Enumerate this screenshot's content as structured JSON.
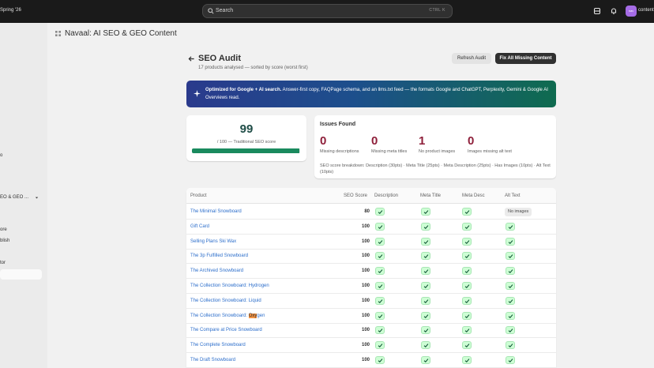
{
  "topbar": {
    "left_text": "Spring '26",
    "search_placeholder": "Search",
    "search_shortcut": "CTRL  K",
    "avatar_initials": "nav",
    "store_name": "content"
  },
  "sidebar": {
    "items": [
      {
        "label": "o"
      },
      {
        "label": "EO & GEO ..."
      },
      {
        "label": "ore"
      },
      {
        "label": "blish"
      },
      {
        "label": "tor"
      }
    ]
  },
  "app": {
    "title": "Navaal: AI SEO & GEO Content"
  },
  "page": {
    "title": "SEO Audit",
    "subtitle": "17 products analysed — sorted by score (worst first)",
    "refresh_label": "Refresh Audit",
    "fix_label": "Fix All Missing Content"
  },
  "banner": {
    "bold": "Optimized for Google + AI search.",
    "text": " Answer-first copy, FAQPage schema, and an llms.txt feed — the formats Google and ChatGPT, Perplexity, Gemini & Google AI Overviews read."
  },
  "score": {
    "value": "99",
    "label": "/ 100 — Traditional SEO score",
    "fill_fraction": 0.99
  },
  "issues": {
    "title": "Issues Found",
    "items": [
      {
        "count": "0",
        "label": "Missing descriptions"
      },
      {
        "count": "0",
        "label": "Missing meta titles"
      },
      {
        "count": "1",
        "label": "No product images"
      },
      {
        "count": "0",
        "label": "Images missing alt text"
      }
    ],
    "note": "SEO score breakdown: Description (30pts) · Meta Title (25pts) · Meta Description (25pts) · Has Images (10pts) · Alt Text (10pts)"
  },
  "table": {
    "headers": [
      "Product",
      "SEO Score",
      "Description",
      "Meta Title",
      "Meta Desc",
      "Alt Text"
    ],
    "rows": [
      {
        "product": "The Minimal Snowboard",
        "score": "80",
        "alt": "No images"
      },
      {
        "product": "Gift Card",
        "score": "100"
      },
      {
        "product": "Selling Plans Ski Wax",
        "score": "100"
      },
      {
        "product": "The 3p Fulfilled Snowboard",
        "score": "100"
      },
      {
        "product": "The Archived Snowboard",
        "score": "100"
      },
      {
        "product": "The Collection Snowboard: Hydrogen",
        "score": "100"
      },
      {
        "product": "The Collection Snowboard: Liquid",
        "score": "100"
      },
      {
        "product_pre": "The Collection Snowboard: ",
        "product_hl": "Oxy",
        "product_post": "gen",
        "score": "100"
      },
      {
        "product": "The Compare at Price Snowboard",
        "score": "100"
      },
      {
        "product": "The Complete Snowboard",
        "score": "100"
      },
      {
        "product": "The Draft Snowboard",
        "score": "100"
      }
    ]
  },
  "colors": {
    "topbar": "#1a1a1a",
    "accent_dark": "#303030",
    "score_green": "#1a8a5e",
    "issue_red": "#8e1f3a",
    "link_blue": "#2c6ecb",
    "check_bg": "#cdfed4"
  }
}
